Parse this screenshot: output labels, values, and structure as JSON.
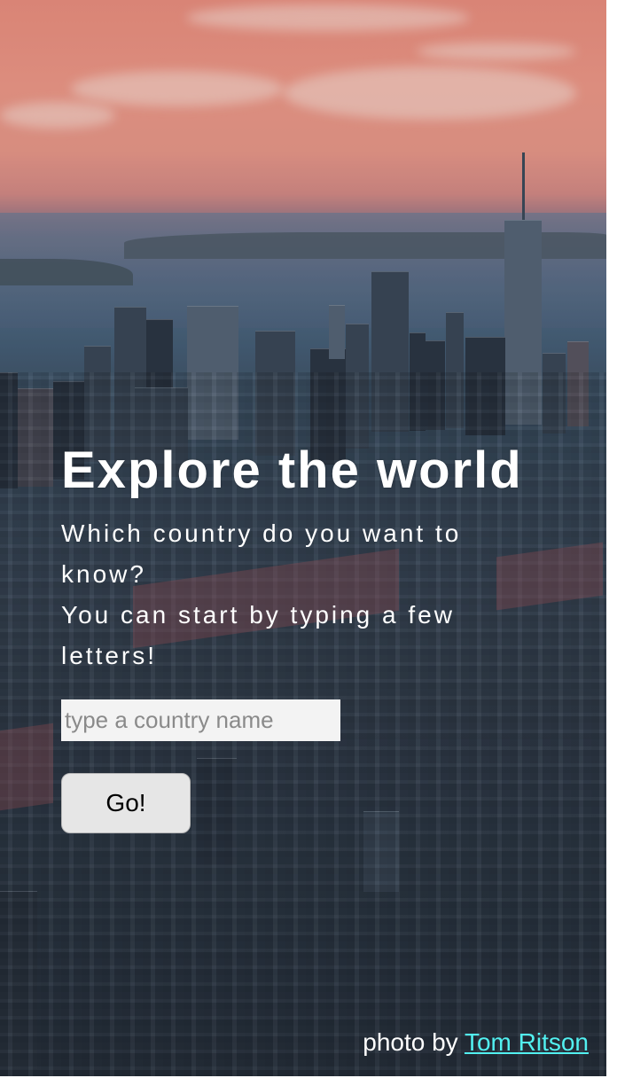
{
  "hero": {
    "title": "Explore the world",
    "subtitle_line1": "Which country do you want to know?",
    "subtitle_line2": "You can start by typing a few letters!"
  },
  "search": {
    "placeholder": "type a country name",
    "value": ""
  },
  "actions": {
    "go_label": "Go!"
  },
  "credit": {
    "prefix": "photo by",
    "author": "Tom Ritson"
  },
  "colors": {
    "sky": "#f0907f",
    "city": "#303b49",
    "text": "#ffffff",
    "link": "#52f0f0",
    "button_bg": "#e6e6e6",
    "input_bg": "#f3f3f3"
  }
}
